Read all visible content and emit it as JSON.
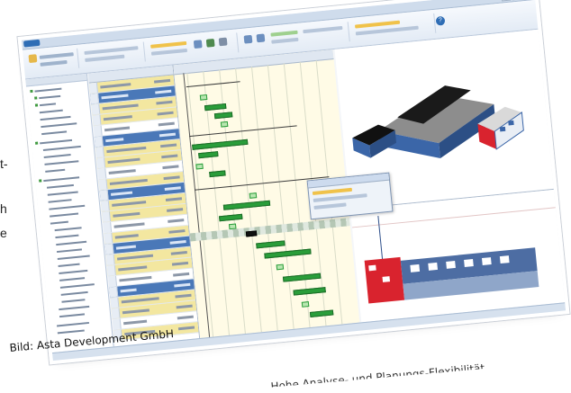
{
  "page": {
    "left_edge_text": [
      "t-",
      "h",
      "e"
    ],
    "caption": "Bild: Asta Development GmbH",
    "bottom_text_partial": "Hohe Analyse- und Planungs-Flexibilität"
  },
  "app": {
    "window_title": "",
    "window_buttons": [
      "–",
      "□",
      "×"
    ],
    "help_label": "?"
  },
  "colors": {
    "ribbon_blue": "#2e6db5",
    "gantt_bar": "#2a9d3a",
    "gantt_background": "#fffbe6",
    "summary_row": "#4a78b8",
    "highlight_row": "#f3e7a0",
    "building_roof": "#1a1a1a",
    "building_red": "#d9232e",
    "building_blue": "#3b66a8"
  },
  "icons": [
    "app-menu-icon",
    "help-icon",
    "folder-icon",
    "gear-icon"
  ]
}
